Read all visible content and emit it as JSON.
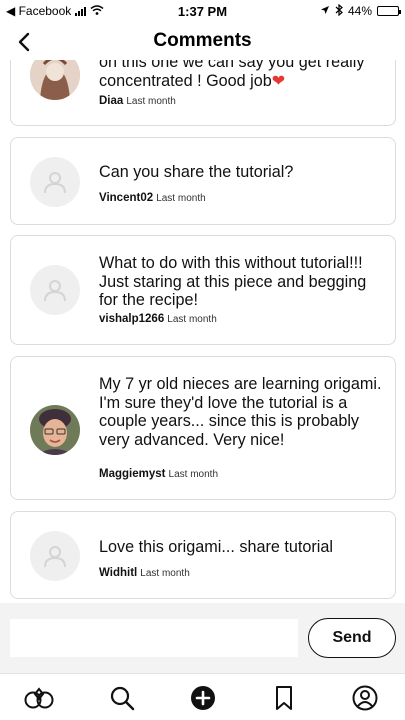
{
  "status_bar": {
    "back_app": "◀ Facebook",
    "time": "1:37 PM",
    "battery": "44%",
    "battery_level": 0.44
  },
  "header": {
    "title": "Comments"
  },
  "comments": [
    {
      "text": "on this one we can say you get really concentrated ! Good job",
      "emoji": "❤",
      "author": "Diaa",
      "time": "Last month"
    },
    {
      "text": "Can you share the tutorial?",
      "author": "Vincent02",
      "time": "Last month"
    },
    {
      "text": "What to do with this without tutorial!!! Just staring at this piece and begging for the recipe!",
      "author": "vishalp1266",
      "time": "Last month"
    },
    {
      "text": "My 7 yr old nieces are learning origami. I'm sure they'd love the tutorial is a couple years... since this is probably very advanced. Very nice!",
      "author": "Maggiemyst",
      "time": "Last month"
    },
    {
      "text": "Love this origami... share tutorial",
      "author": "Widhitl",
      "time": "Last month"
    }
  ],
  "composer": {
    "placeholder": "",
    "send_label": "Send"
  },
  "tabs": [
    "home-icon",
    "search-icon",
    "add-icon",
    "bookmark-icon",
    "profile-icon"
  ]
}
